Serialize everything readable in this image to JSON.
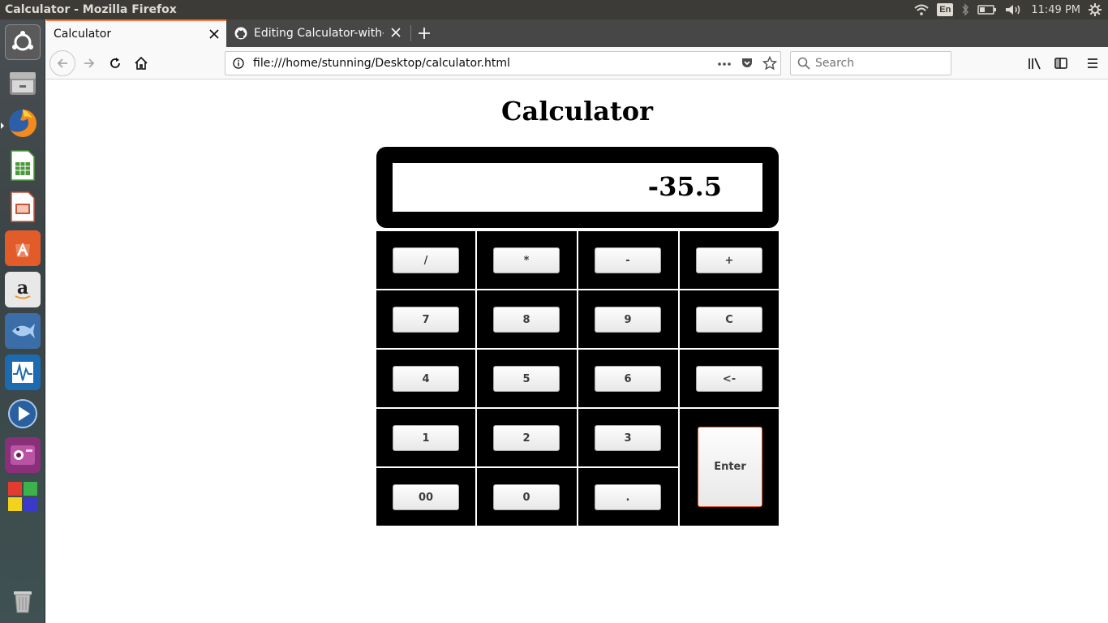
{
  "top_panel": {
    "window_title": "Calculator - Mozilla Firefox",
    "keyboard_layout": "En",
    "clock": "11:49 PM"
  },
  "launcher": {
    "items": [
      "ubuntu-dash",
      "files",
      "firefox",
      "libreoffice-calc",
      "libreoffice-impress",
      "ubuntu-software",
      "amazon",
      "shotwell",
      "system-monitor",
      "videos",
      "cheese",
      "lightworks",
      "trash"
    ]
  },
  "browser": {
    "tabs": [
      {
        "label": "Calculator",
        "active": true
      },
      {
        "label": "Editing Calculator-with-",
        "active": false
      }
    ],
    "url": "file:///home/stunning/Desktop/calculator.html",
    "search_placeholder": "Search"
  },
  "calculator": {
    "title": "Calculator",
    "display": "-35.5",
    "keys": {
      "divide": "/",
      "multiply": "*",
      "subtract": "-",
      "add": "+",
      "seven": "7",
      "eight": "8",
      "nine": "9",
      "clear": "C",
      "four": "4",
      "five": "5",
      "six": "6",
      "backspace": "<-",
      "one": "1",
      "two": "2",
      "three": "3",
      "enter": "Enter",
      "double_zero": "00",
      "zero": "0",
      "decimal": "."
    }
  },
  "colors": {
    "panel_bg": "#3c3b37",
    "tab_strip_bg": "#474747",
    "active_tab_accent": "#ff7139",
    "keypad_bg": "#000000",
    "enter_border": "#e2572c"
  }
}
